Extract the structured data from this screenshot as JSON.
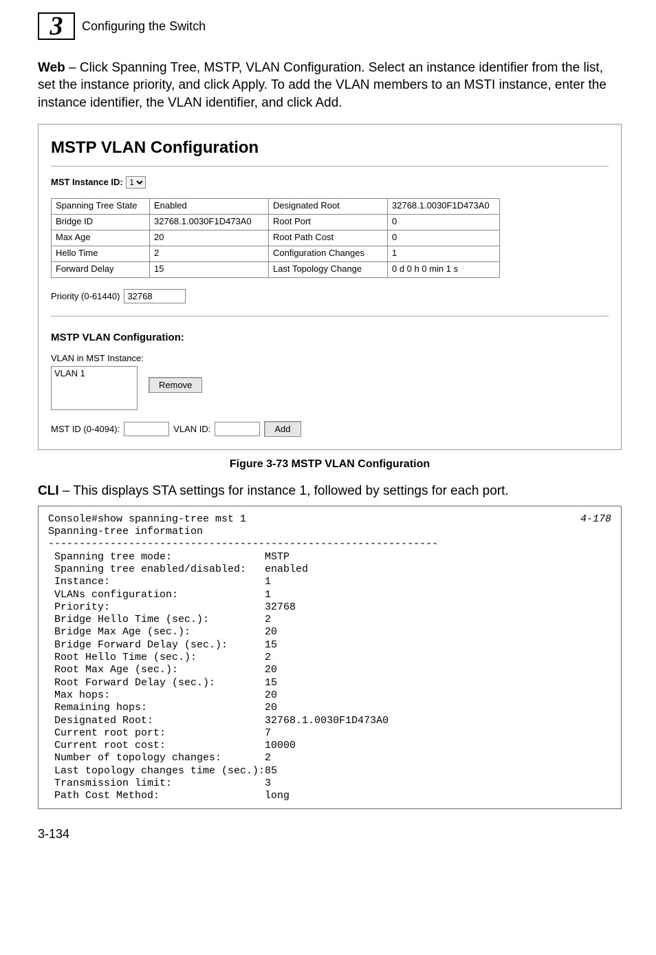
{
  "header": {
    "chapter_number": "3",
    "section_title": "Configuring the Switch"
  },
  "intro": {
    "bold_lead": "Web",
    "text": " – Click Spanning Tree, MSTP, VLAN Configuration. Select an instance identifier from the list, set the instance priority, and click Apply. To add the VLAN members to an MSTI instance, enter the instance identifier, the VLAN identifier, and click Add."
  },
  "panel": {
    "title": "MSTP VLAN Configuration",
    "mst_label": "MST Instance ID:",
    "mst_selected": "1",
    "table": [
      [
        "Spanning Tree State",
        "Enabled",
        "Designated Root",
        "32768.1.0030F1D473A0"
      ],
      [
        "Bridge ID",
        "32768.1.0030F1D473A0",
        "Root Port",
        "0"
      ],
      [
        "Max Age",
        "20",
        "Root Path Cost",
        "0"
      ],
      [
        "Hello Time",
        "2",
        "Configuration Changes",
        "1"
      ],
      [
        "Forward Delay",
        "15",
        "Last Topology Change",
        "0 d 0 h 0 min 1 s"
      ]
    ],
    "priority_label": "Priority (0-61440)",
    "priority_value": "32768",
    "sub_heading": "MSTP VLAN Configuration:",
    "vlan_list_label": "VLAN in MST Instance:",
    "vlan_item": "VLAN 1",
    "remove_btn": "Remove",
    "mst_id_label": "MST ID (0-4094):",
    "vlan_id_label": "VLAN ID:",
    "add_btn": "Add"
  },
  "figure_caption": "Figure 3-73  MSTP VLAN Configuration",
  "cli_intro": {
    "bold_lead": "CLI",
    "text": " – This displays STA settings for instance 1, followed by settings for each port."
  },
  "cli_ref": "4-178",
  "cli_output": "Console#show spanning-tree mst 1\nSpanning-tree information\n---------------------------------------------------------------\n Spanning tree mode:               MSTP\n Spanning tree enabled/disabled:   enabled\n Instance:                         1\n VLANs configuration:              1\n Priority:                         32768\n Bridge Hello Time (sec.):         2\n Bridge Max Age (sec.):            20\n Bridge Forward Delay (sec.):      15\n Root Hello Time (sec.):           2\n Root Max Age (sec.):              20\n Root Forward Delay (sec.):        15\n Max hops:                         20\n Remaining hops:                   20\n Designated Root:                  32768.1.0030F1D473A0\n Current root port:                7\n Current root cost:                10000\n Number of topology changes:       2\n Last topology changes time (sec.):85\n Transmission limit:               3\n Path Cost Method:                 long",
  "page_number": "3-134"
}
